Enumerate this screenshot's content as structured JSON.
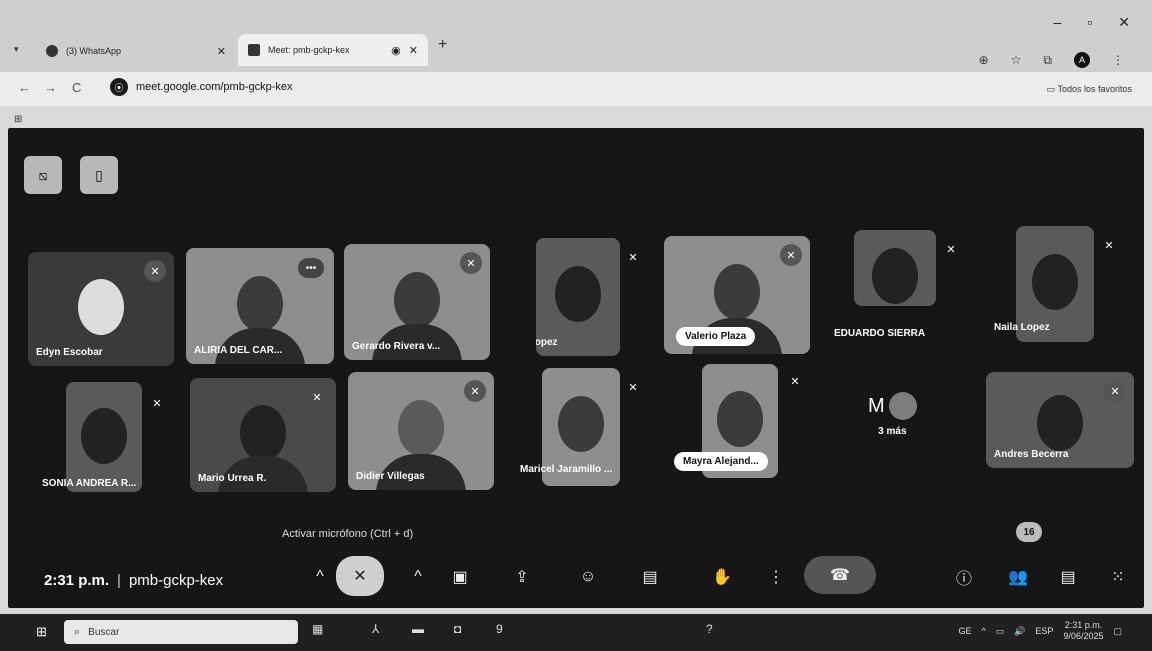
{
  "browser": {
    "tabs": [
      {
        "title": "(3) WhatsApp",
        "active": false
      },
      {
        "title": "Meet: pmb-gckp-kex",
        "active": true
      }
    ],
    "url": "meet.google.com/pmb-gckp-kex",
    "bookmarks_label": "Todos los favoritos",
    "profile_initial": "A"
  },
  "meet": {
    "tooltip": "Activar micrófono (Ctrl + d)",
    "time": "2:31 p.m.",
    "separator": "|",
    "meeting_code": "pmb-gckp-kex",
    "participant_count": "16",
    "row1": [
      {
        "name": "Edyn Escobar"
      },
      {
        "name": "ALIRIA DEL CAR..."
      },
      {
        "name": "Gerardo Rivera v..."
      },
      {
        "name": "lina lopez"
      },
      {
        "name": "Valerio Plaza"
      },
      {
        "name": "EDUARDO SIERRA"
      },
      {
        "name": "Naila Lopez"
      }
    ],
    "row2": [
      {
        "name": "SONIA ANDREA R..."
      },
      {
        "name": "Mario Urrea R."
      },
      {
        "name": "Didier Villegas"
      },
      {
        "name": "Maricel Jaramillo ..."
      },
      {
        "name": "Mayra Alejand..."
      },
      {
        "name": "Andres Becerra"
      }
    ],
    "more": {
      "initial": "M",
      "label": "3 más"
    }
  },
  "taskbar": {
    "search_placeholder": "Buscar",
    "lang": "ESP",
    "keyboard": "GE",
    "time": "2:31 p.m.",
    "date": "9/06/2025"
  }
}
